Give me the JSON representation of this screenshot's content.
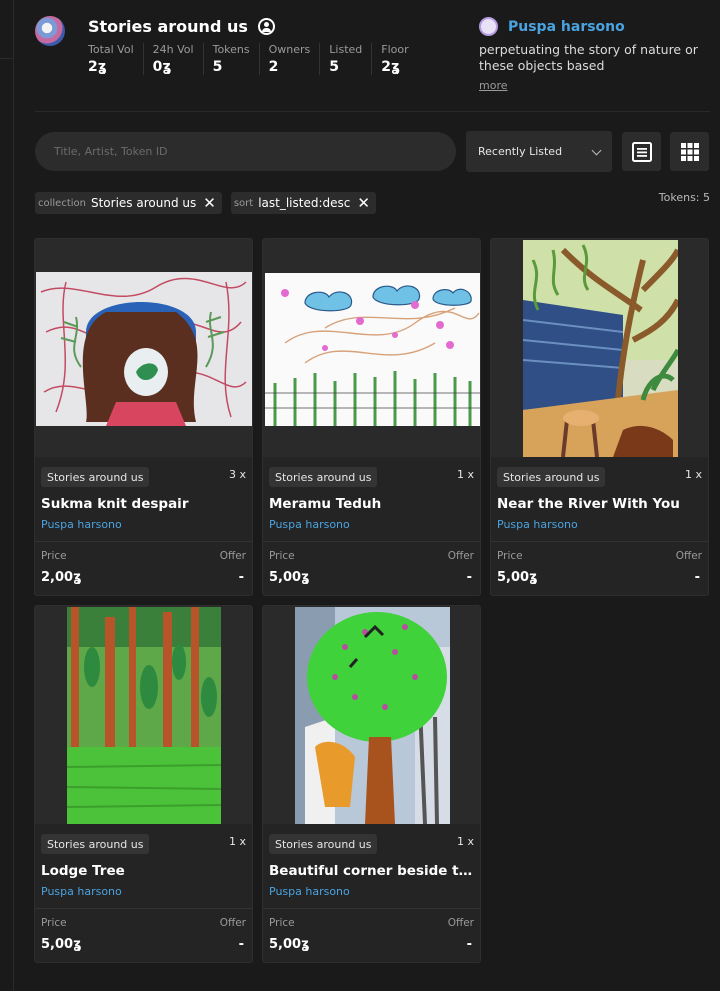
{
  "collection": {
    "title": "Stories around us",
    "stats": [
      {
        "label": "Total Vol",
        "value": "2ʓ"
      },
      {
        "label": "24h Vol",
        "value": "0ʓ"
      },
      {
        "label": "Tokens",
        "value": "5"
      },
      {
        "label": "Owners",
        "value": "2"
      },
      {
        "label": "Listed",
        "value": "5"
      },
      {
        "label": "Floor",
        "value": "2ʓ"
      }
    ]
  },
  "creator": {
    "name": "Puspa harsono",
    "description": "perpetuating the story of nature or these objects based",
    "more_label": "more"
  },
  "search": {
    "placeholder": "Title, Artist, Token ID"
  },
  "sort": {
    "selected": "Recently Listed"
  },
  "filters": [
    {
      "key": "collection",
      "value": "Stories around us"
    },
    {
      "key": "sort",
      "value": "last_listed:desc"
    }
  ],
  "tokens_count": "Tokens: 5",
  "cards": [
    {
      "collection": "Stories around us",
      "qty": "3 x",
      "title": "Sukma knit despair",
      "artist": "Puspa harsono",
      "price_label": "Price",
      "offer_label": "Offer",
      "price": "2,00ʓ",
      "offer": "-"
    },
    {
      "collection": "Stories around us",
      "qty": "1 x",
      "title": "Meramu Teduh",
      "artist": "Puspa harsono",
      "price_label": "Price",
      "offer_label": "Offer",
      "price": "5,00ʓ",
      "offer": "-"
    },
    {
      "collection": "Stories around us",
      "qty": "1 x",
      "title": "Near the River With You",
      "artist": "Puspa harsono",
      "price_label": "Price",
      "offer_label": "Offer",
      "price": "5,00ʓ",
      "offer": "-"
    },
    {
      "collection": "Stories around us",
      "qty": "1 x",
      "title": "Lodge Tree",
      "artist": "Puspa harsono",
      "price_label": "Price",
      "offer_label": "Offer",
      "price": "5,00ʓ",
      "offer": "-"
    },
    {
      "collection": "Stories around us",
      "qty": "1 x",
      "title": "Beautiful corner beside th...",
      "artist": "Puspa harsono",
      "price_label": "Price",
      "offer_label": "Offer",
      "price": "5,00ʓ",
      "offer": "-"
    }
  ]
}
